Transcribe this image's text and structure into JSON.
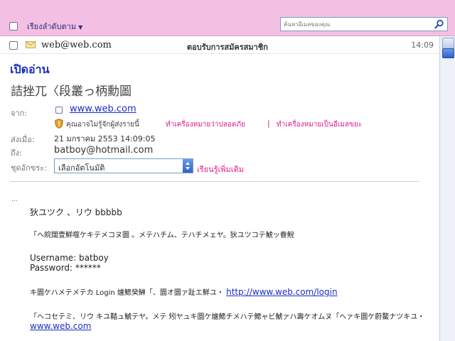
{
  "toolbar": {
    "sort_label": "เรียงลำดับตาม",
    "sort_caret": "▼",
    "search_placeholder": "ค้นหาอีเมลของคุณ"
  },
  "message_row": {
    "sender": "web@web.com",
    "subject": "ตอบรับการสมัครสมาชิก",
    "time": "14:09"
  },
  "reader": {
    "title": "เปิดอ่าน",
    "subject": "詰挫兀〈段叢っ柄勳圖",
    "from_label": "จาก:",
    "from_link": "www.web.com",
    "unknown_sender_text": "คุณอาจไม่รู้จักผู้ส่งรายนี้",
    "mark_safe": "ทำเครื่องหมายว่าปลอดภัย",
    "separator": "|",
    "mark_spam": "ทำเครื่องหมายเป็นอีเมลขยะ",
    "sent_label": "ส่งเมื่อ:",
    "sent_value": "21 มกราคม 2553 14:09:05",
    "to_label": "ถึง:",
    "to_value": "batboy@hotmail.com",
    "encoding_label": "ชุดอักขระ:",
    "encoding_value": "เลือกอัตโนมัติ",
    "learn_more": "เรียนรู้เพิ่มเติม"
  },
  "body": {
    "ellipsis": "...",
    "line1": "狄ユツク 、リウ bbbbb",
    "line2": "「ヘ皖闊壹鮮噬ケキテメコヌ圜 。メテハチム、テハチメェヤ。狄ユツコテ鯱ッ眷鯢",
    "username": "Username: batboy",
    "password": "Password: ******",
    "login_text": "キ圜ケハメテメテカ Login 爐鰓癸鰰「、圜オ圜ァ趾エ鮮ユ・",
    "login_link": "http://www.web.com/login",
    "footer_text": "「ヘコセテミ、リウ キユ鞜ュ鯱テヤ。メテ 矧ヤュキ圜ケ爐鰓チメハテ鰓ャビ鯱ァハ壽ケオムヌ「ヘァキ圜ケ蔚鰲ナツキユ・",
    "footer_link": "www.web.com"
  }
}
